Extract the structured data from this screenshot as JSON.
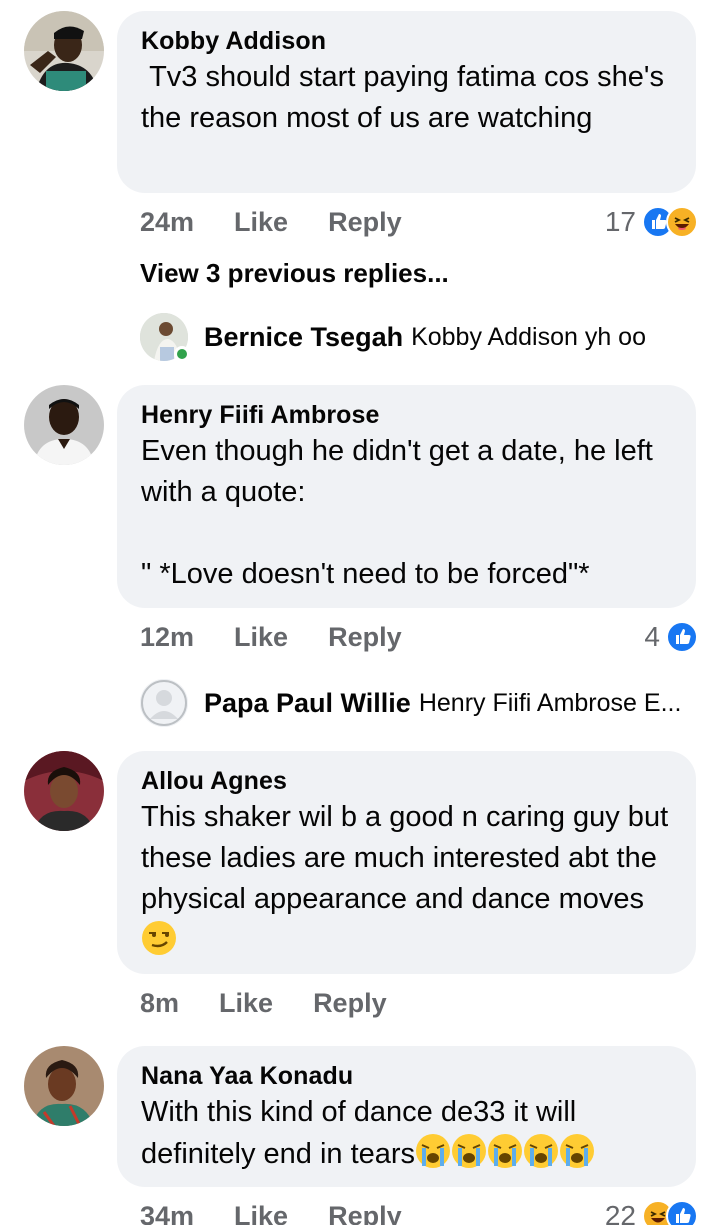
{
  "colors": {
    "bubble": "#f0f2f5",
    "meta_text": "#65676b",
    "like_blue": "#1877f2",
    "online_green": "#31a24c"
  },
  "comments": [
    {
      "author": "Kobby Addison",
      "text": " Tv3 should start paying fatima cos she's the reason most of us are watching",
      "time": "24m",
      "like_label": "Like",
      "reply_label": "Reply",
      "reaction_count": "17",
      "reaction_icons": [
        "like-icon",
        "haha-icon"
      ],
      "view_previous": "View 3 previous replies...",
      "reply": {
        "author": "Bernice Tsegah",
        "text": "Kobby Addison yh oo"
      }
    },
    {
      "author": "Henry Fiifi Ambrose",
      "text": "Even though he didn't get a date, he left with a quote:\n\n\" *Love doesn't need to be forced\"*",
      "time": "12m",
      "like_label": "Like",
      "reply_label": "Reply",
      "reaction_count": "4",
      "reaction_icons": [
        "like-icon"
      ],
      "reply": {
        "author": "Papa Paul Willie",
        "text": "Henry Fiifi Ambrose E..."
      }
    },
    {
      "author": "Allou Agnes",
      "text": "This shaker wil b a good n caring guy but these ladies are much interested abt the physical appearance and dance moves",
      "text_emoji": "smirk-emoji",
      "time": "8m",
      "like_label": "Like",
      "reply_label": "Reply"
    },
    {
      "author": "Nana Yaa Konadu",
      "text": "With this kind of dance de33 it will definitely end in tears",
      "text_emoji": "loudly-crying-emoji x5",
      "time": "34m",
      "like_label": "Like",
      "reply_label": "Reply",
      "reaction_count": "22",
      "reaction_icons": [
        "haha-icon",
        "like-icon"
      ]
    }
  ]
}
